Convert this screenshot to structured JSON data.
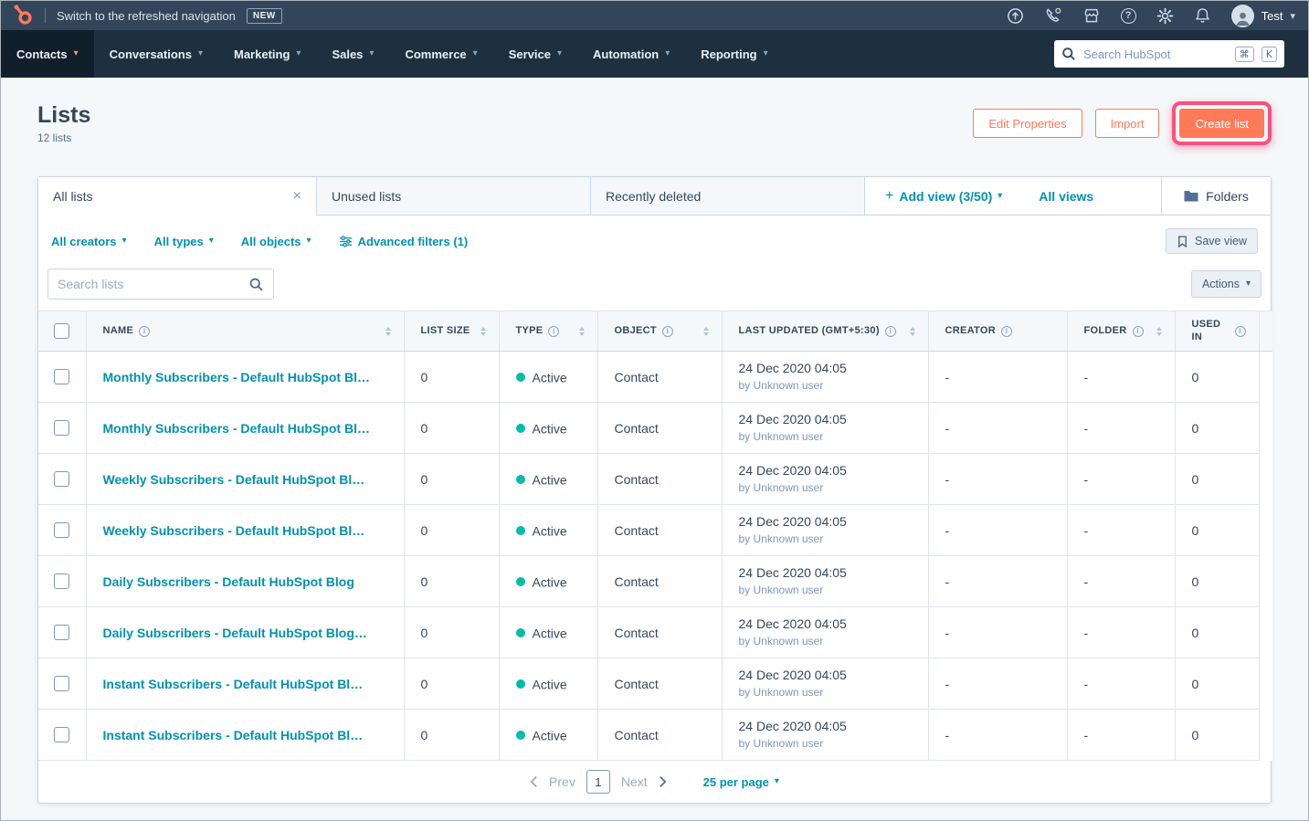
{
  "topbar": {
    "switch_text": "Switch to the refreshed navigation",
    "new_badge": "NEW",
    "user_name": "Test"
  },
  "nav": {
    "items": [
      "Contacts",
      "Conversations",
      "Marketing",
      "Sales",
      "Commerce",
      "Service",
      "Automation",
      "Reporting"
    ],
    "search_placeholder": "Search HubSpot",
    "shortcut_cmd": "⌘",
    "shortcut_key": "K"
  },
  "header": {
    "title": "Lists",
    "count": "12 lists",
    "buttons": {
      "edit_properties": "Edit Properties",
      "import": "Import",
      "create_list": "Create list"
    }
  },
  "tabs": {
    "all_lists": "All lists",
    "unused_lists": "Unused lists",
    "recently_deleted": "Recently deleted",
    "add_view": "Add view (3/50)",
    "all_views": "All views",
    "folders": "Folders"
  },
  "filters": {
    "creators": "All creators",
    "types": "All types",
    "objects": "All objects",
    "advanced": "Advanced filters (1)",
    "save_view": "Save view"
  },
  "toolbar": {
    "search_placeholder": "Search lists",
    "actions": "Actions"
  },
  "table": {
    "columns": {
      "name": "NAME",
      "list_size": "LIST SIZE",
      "type": "TYPE",
      "object": "OBJECT",
      "last_updated": "LAST UPDATED (GMT+5:30)",
      "creator": "CREATOR",
      "folder": "FOLDER",
      "used_in": "USED IN"
    },
    "rows": [
      {
        "name": "Monthly Subscribers - Default HubSpot Bl…",
        "size": "0",
        "status": "Active",
        "object": "Contact",
        "updated": "24 Dec 2020 04:05",
        "updated_by": "by Unknown user",
        "creator": "-",
        "folder": "-",
        "used_in": "0"
      },
      {
        "name": "Monthly Subscribers - Default HubSpot Bl…",
        "size": "0",
        "status": "Active",
        "object": "Contact",
        "updated": "24 Dec 2020 04:05",
        "updated_by": "by Unknown user",
        "creator": "-",
        "folder": "-",
        "used_in": "0"
      },
      {
        "name": "Weekly Subscribers - Default HubSpot Bl…",
        "size": "0",
        "status": "Active",
        "object": "Contact",
        "updated": "24 Dec 2020 04:05",
        "updated_by": "by Unknown user",
        "creator": "-",
        "folder": "-",
        "used_in": "0"
      },
      {
        "name": "Weekly Subscribers - Default HubSpot Bl…",
        "size": "0",
        "status": "Active",
        "object": "Contact",
        "updated": "24 Dec 2020 04:05",
        "updated_by": "by Unknown user",
        "creator": "-",
        "folder": "-",
        "used_in": "0"
      },
      {
        "name": "Daily Subscribers - Default HubSpot Blog",
        "size": "0",
        "status": "Active",
        "object": "Contact",
        "updated": "24 Dec 2020 04:05",
        "updated_by": "by Unknown user",
        "creator": "-",
        "folder": "-",
        "used_in": "0"
      },
      {
        "name": "Daily Subscribers - Default HubSpot Blog…",
        "size": "0",
        "status": "Active",
        "object": "Contact",
        "updated": "24 Dec 2020 04:05",
        "updated_by": "by Unknown user",
        "creator": "-",
        "folder": "-",
        "used_in": "0"
      },
      {
        "name": "Instant Subscribers - Default HubSpot Bl…",
        "size": "0",
        "status": "Active",
        "object": "Contact",
        "updated": "24 Dec 2020 04:05",
        "updated_by": "by Unknown user",
        "creator": "-",
        "folder": "-",
        "used_in": "0"
      },
      {
        "name": "Instant Subscribers - Default HubSpot Bl…",
        "size": "0",
        "status": "Active",
        "object": "Contact",
        "updated": "24 Dec 2020 04:05",
        "updated_by": "by Unknown user",
        "creator": "-",
        "folder": "-",
        "used_in": "0"
      }
    ]
  },
  "pagination": {
    "prev": "Prev",
    "page": "1",
    "next": "Next",
    "per_page": "25 per page"
  },
  "colors": {
    "accent": "#ff7a59",
    "link": "#0091ae",
    "active_dot": "#00bda5",
    "highlight_ring": "#f8517d"
  }
}
